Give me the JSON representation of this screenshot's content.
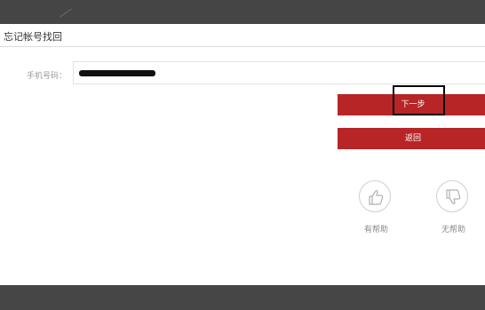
{
  "dialog": {
    "title": "忘记帐号找回"
  },
  "form": {
    "phone_label": "手机号码：",
    "phone_value_redacted": true
  },
  "buttons": {
    "next_label": "下一步",
    "back_label": "返回"
  },
  "feedback": {
    "helpful_label": "有帮助",
    "not_helpful_label": "无帮助",
    "helpful_icon": "thumbs-up-icon",
    "not_helpful_icon": "thumbs-down-icon"
  },
  "colors": {
    "button_bg": "#b82526",
    "overlay": "#464646"
  }
}
